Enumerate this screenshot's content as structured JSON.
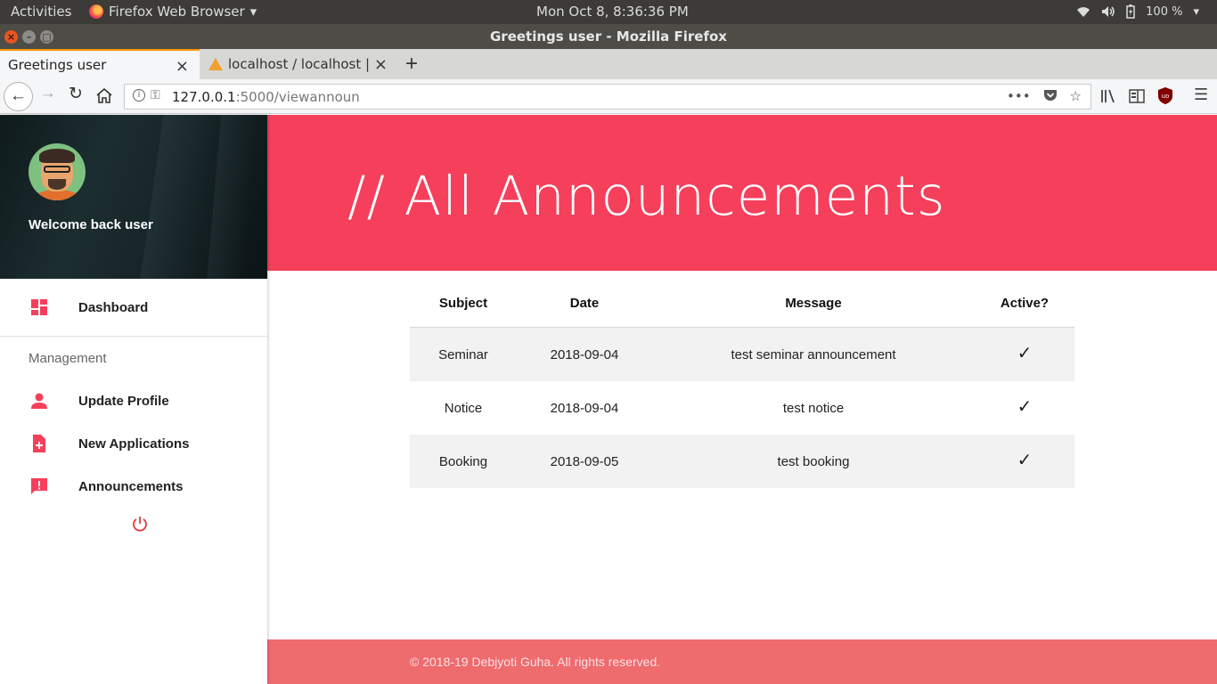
{
  "system_bar": {
    "activities": "Activities",
    "app_name": "Firefox Web Browser",
    "clock": "Mon Oct  8,  8:36:36 PM",
    "battery": "100 %"
  },
  "window": {
    "title": "Greetings user - Mozilla Firefox"
  },
  "tabs": [
    {
      "label": "Greetings user",
      "active": true
    },
    {
      "label": "localhost / localhost | phpMyAdmin",
      "active": false
    }
  ],
  "address_bar": {
    "url_host": "127.0.0.1",
    "url_rest": ":5000/viewannoun"
  },
  "sidebar": {
    "welcome": "Welcome back user",
    "dashboard": "Dashboard",
    "section": "Management",
    "items": [
      {
        "label": "Update Profile",
        "icon": "person-icon"
      },
      {
        "label": "New Applications",
        "icon": "document-add-icon"
      },
      {
        "label": "Announcements",
        "icon": "announcement-icon"
      }
    ],
    "accent_color": "#f53f5b"
  },
  "banner": {
    "title": "// All Announcements",
    "color": "#f53f5b"
  },
  "table": {
    "headers": [
      "Subject",
      "Date",
      "Message",
      "Active?"
    ],
    "rows": [
      {
        "subject": "Seminar",
        "date": "2018-09-04",
        "message": "test seminar announcement",
        "active": "✓"
      },
      {
        "subject": "Notice",
        "date": "2018-09-04",
        "message": "test notice",
        "active": "✓"
      },
      {
        "subject": "Booking",
        "date": "2018-09-05",
        "message": "test booking",
        "active": "✓"
      }
    ]
  },
  "footer": {
    "text": "© 2018-19 Debjyoti Guha. All rights reserved.",
    "color": "#ee6b6e"
  }
}
